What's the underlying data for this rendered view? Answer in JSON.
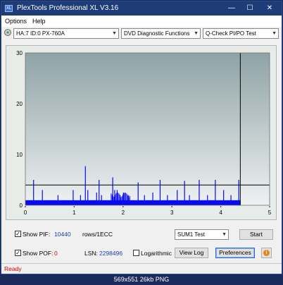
{
  "window": {
    "title": "PlexTools Professional XL V3.16",
    "icon_label": "XL",
    "controls": {
      "minimize": "—",
      "maximize": "☐",
      "close": "✕"
    }
  },
  "menu": {
    "options": "Options",
    "help": "Help"
  },
  "toolbar": {
    "drive": "HA:7 ID:0  PX-760A",
    "function": "DVD Diagnostic Functions",
    "test": "Q-Check PI/PO Test"
  },
  "colors": {
    "bars": "#0a0af0",
    "threshold_line": "#000000",
    "end_marker": "#000000",
    "title_bar": "#1e3d78",
    "status_red": "#e00000"
  },
  "chart_data": {
    "type": "bar",
    "x_ticks": [
      "0",
      "1",
      "2",
      "3",
      "4",
      "5"
    ],
    "y_ticks": [
      "0",
      "10",
      "20",
      "30"
    ],
    "xlim": [
      0,
      5
    ],
    "ylim": [
      0,
      30
    ],
    "threshold": 4,
    "end_x": 4.4,
    "grid": false,
    "series": [
      {
        "baseline": 1,
        "spikes": [
          {
            "x": 0.16,
            "y": 5
          },
          {
            "x": 0.34,
            "y": 3
          },
          {
            "x": 0.66,
            "y": 2
          },
          {
            "x": 0.97,
            "y": 3
          },
          {
            "x": 1.12,
            "y": 2
          },
          {
            "x": 1.22,
            "y": 7.7
          },
          {
            "x": 1.27,
            "y": 3
          },
          {
            "x": 1.45,
            "y": 2.5
          },
          {
            "x": 1.5,
            "y": 5
          },
          {
            "x": 1.55,
            "y": 2
          },
          {
            "x": 1.78,
            "y": 5.5
          },
          {
            "x": 1.82,
            "y": 3
          },
          {
            "x": 1.87,
            "y": 3
          },
          {
            "x": 1.93,
            "y": 2
          },
          {
            "x": 2.0,
            "y": 2.5
          },
          {
            "x": 2.1,
            "y": 2
          },
          {
            "x": 2.3,
            "y": 4.5
          },
          {
            "x": 2.43,
            "y": 2
          },
          {
            "x": 2.6,
            "y": 2.5
          },
          {
            "x": 2.75,
            "y": 5
          },
          {
            "x": 2.9,
            "y": 2
          },
          {
            "x": 3.1,
            "y": 3
          },
          {
            "x": 3.25,
            "y": 4.8
          },
          {
            "x": 3.35,
            "y": 2
          },
          {
            "x": 3.55,
            "y": 5
          },
          {
            "x": 3.72,
            "y": 2
          },
          {
            "x": 3.88,
            "y": 5
          },
          {
            "x": 4.05,
            "y": 3
          },
          {
            "x": 4.2,
            "y": 2
          },
          {
            "x": 4.36,
            "y": 5
          }
        ],
        "dense_region": [
          1.75,
          2.15
        ],
        "dense_level": 2.5
      }
    ]
  },
  "bottom": {
    "show_pif_label": "Show PIF:",
    "pif_value": "10440",
    "pif_unit": "rows/1ECC",
    "show_pof_label": "Show POF:",
    "pof_value": "0",
    "lsn_label": "LSN:",
    "lsn_value": "2298496",
    "logarithmic_label": "Logarithmic",
    "sum_select": "SUM1 Test",
    "start_button": "Start",
    "view_log_button": "View Log",
    "preferences_button": "Preferences",
    "info_icon": "i",
    "check_mark": "✓"
  },
  "status": {
    "text": "Ready"
  },
  "footer": {
    "text": "569x551  26kb  PNG"
  }
}
